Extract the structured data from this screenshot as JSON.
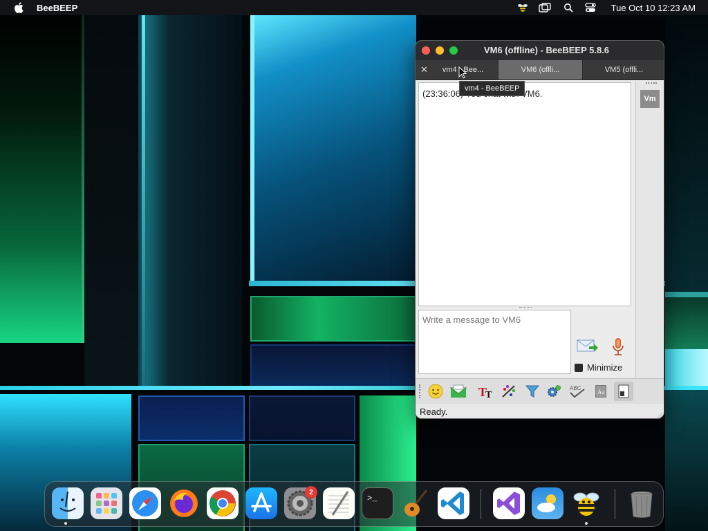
{
  "menubar": {
    "app_name": "BeeBEEP",
    "clock": "Tue Oct 10  12:23 AM",
    "icons": [
      "bee-icon",
      "screen-mirroring-icon",
      "search-icon",
      "control-center-icon"
    ]
  },
  "window": {
    "title": "VM6 (offline) - BeeBEEP 5.8.6",
    "tabs": [
      {
        "label": "vm4 - Bee..."
      },
      {
        "label": "VM6 (offli..."
      },
      {
        "label": "VM5 (offli..."
      }
    ],
    "tooltip": "vm4 - BeeBEEP",
    "chat": {
      "line": "(23:36:06) You chat with VM6."
    },
    "member_avatar": "Vm",
    "input": {
      "placeholder": "Write a message to VM6",
      "value": ""
    },
    "minimize_label": "Minimize",
    "minimize_checked": false,
    "toolbar_icons": [
      "emoji-icon",
      "envelope-icon",
      "font-icon",
      "color-icon",
      "filter-icon",
      "settings-icon",
      "spellcheck-icon",
      "dictionary-icon",
      "document-icon"
    ],
    "status": "Ready."
  },
  "dock": {
    "apps": [
      "Finder",
      "Launchpad",
      "Safari",
      "Firefox",
      "Chrome",
      "App Store",
      "System Settings",
      "TextEdit",
      "Terminal",
      "GarageBand",
      "Visual Studio Code",
      "Visual Studio",
      "Weather",
      "BeeBEEP",
      "Trash"
    ],
    "system_settings_badge": "2"
  },
  "colors": {
    "traffic_close": "#fe5f57",
    "traffic_minimize": "#febc2e",
    "traffic_maximize": "#28c840",
    "badge": "#e53935"
  }
}
